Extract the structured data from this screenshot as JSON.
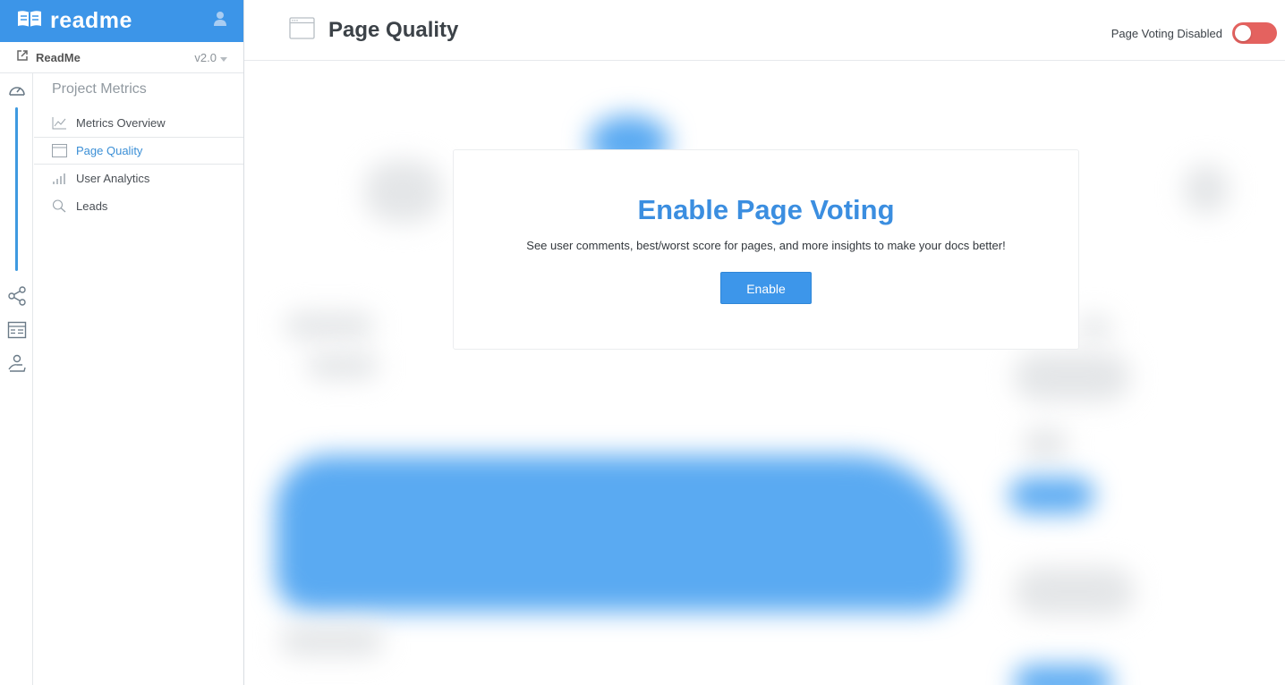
{
  "brand": {
    "name": "readme"
  },
  "project": {
    "name": "ReadMe",
    "version": "v2.0"
  },
  "nav": {
    "section_title": "Project Metrics",
    "items": [
      {
        "label": "Metrics Overview",
        "icon": "line-chart-icon"
      },
      {
        "label": "Page Quality",
        "icon": "browser-window-icon",
        "active": true
      },
      {
        "label": "User Analytics",
        "icon": "bar-chart-icon"
      },
      {
        "label": "Leads",
        "icon": "magnifier-icon"
      }
    ]
  },
  "rail": {
    "icons": [
      "gauge-icon",
      "share-icon",
      "api-reference-icon",
      "user-hand-icon"
    ]
  },
  "header": {
    "title": "Page Quality",
    "toggle_label": "Page Voting Disabled",
    "toggle_on": false
  },
  "card": {
    "title": "Enable Page Voting",
    "subtitle": "See user comments, best/worst score for pages, and more insights to make your docs better!",
    "button_label": "Enable"
  },
  "colors": {
    "brand": "#3c95e8",
    "accent": "#3b8ee0",
    "toggle_off": "#e4625f"
  }
}
